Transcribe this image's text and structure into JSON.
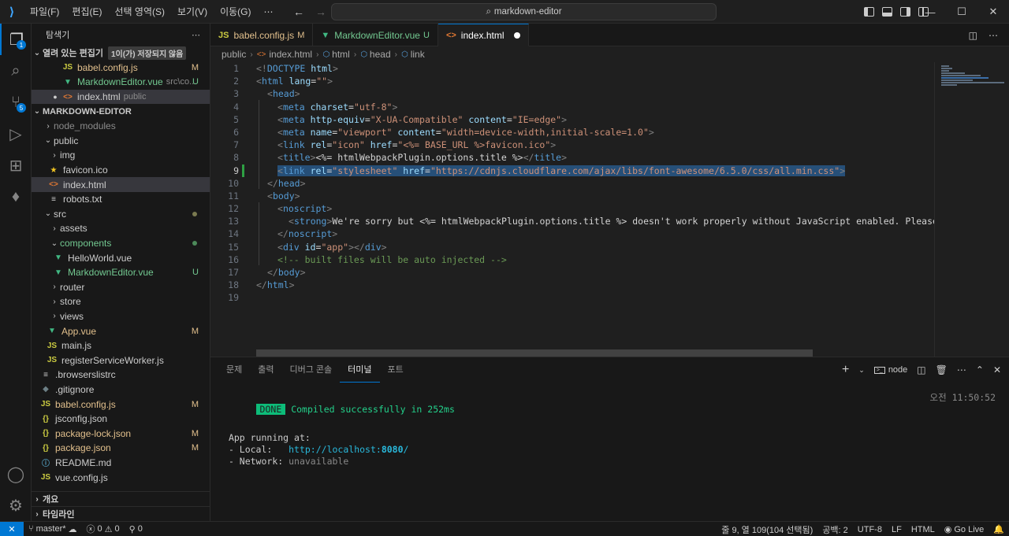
{
  "titlebar": {
    "menu": [
      "파일(F)",
      "편집(E)",
      "선택 영역(S)",
      "보기(V)",
      "이동(G)",
      "⋯"
    ],
    "search_text": "markdown-editor"
  },
  "activity": {
    "explorer_badge": "1",
    "scm_badge": "5"
  },
  "sidebar": {
    "title": "탐색기",
    "more": "⋯",
    "open_editors": {
      "label": "열려 있는 편집기",
      "unsaved_pill": "1이(가) 저장되지 않음",
      "items": [
        {
          "name": "babel.config.js",
          "desc": "",
          "status": "M"
        },
        {
          "name": "MarkdownEditor.vue",
          "desc": "src\\co...",
          "status": "U"
        },
        {
          "name": "index.html",
          "desc": "public",
          "status": ""
        }
      ]
    },
    "project": {
      "label": "MARKDOWN-EDITOR",
      "items": [
        {
          "name": "node_modules",
          "status": ""
        },
        {
          "name": "public",
          "status": ""
        },
        {
          "name": "img",
          "status": ""
        },
        {
          "name": "favicon.ico",
          "status": ""
        },
        {
          "name": "index.html",
          "status": ""
        },
        {
          "name": "robots.txt",
          "status": ""
        },
        {
          "name": "src",
          "status": ""
        },
        {
          "name": "assets",
          "status": ""
        },
        {
          "name": "components",
          "status": ""
        },
        {
          "name": "HelloWorld.vue",
          "status": ""
        },
        {
          "name": "MarkdownEditor.vue",
          "status": "U"
        },
        {
          "name": "router",
          "status": ""
        },
        {
          "name": "store",
          "status": ""
        },
        {
          "name": "views",
          "status": ""
        },
        {
          "name": "App.vue",
          "status": "M"
        },
        {
          "name": "main.js",
          "status": ""
        },
        {
          "name": "registerServiceWorker.js",
          "status": ""
        },
        {
          "name": ".browserslistrc",
          "status": ""
        },
        {
          "name": ".gitignore",
          "status": ""
        },
        {
          "name": "babel.config.js",
          "status": "M"
        },
        {
          "name": "jsconfig.json",
          "status": ""
        },
        {
          "name": "package-lock.json",
          "status": "M"
        },
        {
          "name": "package.json",
          "status": "M"
        },
        {
          "name": "README.md",
          "status": ""
        },
        {
          "name": "vue.config.js",
          "status": ""
        }
      ]
    },
    "outline_label": "개요",
    "timeline_label": "타임라인"
  },
  "tabs": [
    {
      "name": "babel.config.js",
      "status": "M"
    },
    {
      "name": "MarkdownEditor.vue",
      "status": "U"
    },
    {
      "name": "index.html",
      "status": ""
    }
  ],
  "breadcrumb": [
    "public",
    "index.html",
    "html",
    "head",
    "link"
  ],
  "editor": {
    "line_numbers": [
      "1",
      "2",
      "3",
      "4",
      "5",
      "6",
      "7",
      "8",
      "9",
      "10",
      "11",
      "12",
      "13",
      "14",
      "15",
      "16",
      "17",
      "18",
      "19"
    ],
    "l1": {
      "a": "<!",
      "b": "DOCTYPE",
      "c": " html",
      "d": ">"
    },
    "l2": {
      "a": "<",
      "b": "html",
      "c": " lang",
      "d": "=",
      "e": "\"\"",
      "f": ">"
    },
    "l3": {
      "a": "<",
      "b": "head",
      "c": ">"
    },
    "l4": {
      "a": "<",
      "b": "meta",
      "c": " charset",
      "d": "=",
      "e": "\"utf-8\"",
      "f": ">"
    },
    "l5": {
      "a": "<",
      "b": "meta",
      "c": " http-equiv",
      "d": "=",
      "e": "\"X-UA-Compatible\"",
      "f": " content",
      "g": "=",
      "h": "\"IE=edge\"",
      "i": ">"
    },
    "l6": {
      "a": "<",
      "b": "meta",
      "c": " name",
      "d": "=",
      "e": "\"viewport\"",
      "f": " content",
      "g": "=",
      "h": "\"width=device-width,initial-scale=1.0\"",
      "i": ">"
    },
    "l7": {
      "a": "<",
      "b": "link",
      "c": " rel",
      "d": "=",
      "e": "\"icon\"",
      "f": " href",
      "g": "=",
      "h": "\"<%= BASE_URL %>favicon.ico\"",
      "i": ">"
    },
    "l8": {
      "a": "<",
      "b": "title",
      "c": ">",
      "d": "<%= htmlWebpackPlugin.options.title %>",
      "e": "</",
      "f": "title",
      "g": ">"
    },
    "l9": {
      "a": "<",
      "b": "link",
      "c": " rel",
      "d": "=",
      "e": "\"stylesheet\"",
      "f": " href",
      "g": "=",
      "h": "\"https://cdnjs.cloudflare.com/ajax/libs/font-awesome/6.5.0/css/all.min.css\"",
      "i": ">"
    },
    "l10": {
      "a": "</",
      "b": "head",
      "c": ">"
    },
    "l11": {
      "a": "<",
      "b": "body",
      "c": ">"
    },
    "l12": {
      "a": "<",
      "b": "noscript",
      "c": ">"
    },
    "l13": {
      "a": "<",
      "b": "strong",
      "c": ">",
      "d": "We're sorry but <%= htmlWebpackPlugin.options.title %> doesn't work properly without JavaScript enabled. Please enable"
    },
    "l14": {
      "a": "</",
      "b": "noscript",
      "c": ">"
    },
    "l15": {
      "a": "<",
      "b": "div",
      "c": " id",
      "d": "=",
      "e": "\"app\"",
      "f": "></",
      "g": "div",
      "h": ">"
    },
    "l16": {
      "a": "<!-- built files will be auto injected -->"
    },
    "l17": {
      "a": "</",
      "b": "body",
      "c": ">"
    },
    "l18": {
      "a": "</",
      "b": "html",
      "c": ">"
    }
  },
  "panel": {
    "tabs": [
      "문제",
      "출력",
      "디버그 콘솔",
      "터미널",
      "포트"
    ],
    "terminal_name": "node",
    "plus": "+",
    "done_label": "DONE",
    "compiled": "Compiled successfully in 252ms",
    "time": "오전 11:50:52",
    "app_running": "App running at:",
    "local_label": "- Local:   ",
    "local_url_a": "http://localhost:",
    "local_url_port": "8080",
    "local_url_b": "/",
    "network_label": "- Network: ",
    "network_value": "unavailable"
  },
  "statusbar": {
    "branch": "master*",
    "errors": "0",
    "warnings": "0",
    "ports": "0",
    "position": "줄 9, 열 109(104 선택됨)",
    "spaces": "공백: 2",
    "encoding": "UTF-8",
    "eol": "LF",
    "language": "HTML",
    "golive": "Go Live"
  }
}
